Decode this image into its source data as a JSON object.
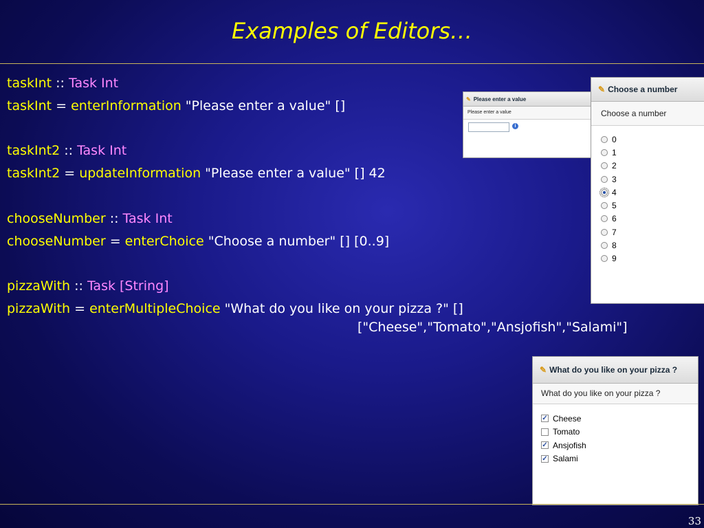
{
  "slide": {
    "title": "Examples of Editors…",
    "page_number": "33"
  },
  "code": {
    "l1": {
      "name": "taskInt",
      "op": " :: ",
      "type": "Task Int"
    },
    "l2": {
      "name": "taskInt",
      "op": " = ",
      "fn": "enterInformation",
      "rest": " \"Please enter a value\" []"
    },
    "l3": {
      "name": "taskInt2",
      "op": " :: ",
      "type": "Task Int"
    },
    "l4": {
      "name": "taskInt2",
      "op": " = ",
      "fn": "updateInformation",
      "rest": " \"Please enter a value\" [] 42"
    },
    "l5": {
      "name": "chooseNumber",
      "op": " :: ",
      "type": "Task Int"
    },
    "l6": {
      "name": "chooseNumber",
      "op": " = ",
      "fn": "enterChoice",
      "rest": " \"Choose a number\" [] [0..9]"
    },
    "l7": {
      "name": "pizzaWith",
      "op": " :: ",
      "type": "Task [String]"
    },
    "l8": {
      "name": "pizzaWith",
      "op": " = ",
      "fn": "enterMultipleChoice",
      "rest": " \"What do you like on your pizza ?\" []"
    },
    "l9": {
      "rest": "[\"Cheese\",\"Tomato\",\"Ansjofish\",\"Salami\"]"
    }
  },
  "panel_enter_value": {
    "header": "Please enter a value",
    "prompt": "Please enter a value",
    "input_value": "",
    "info_icon": "info-icon"
  },
  "panel_choose_number": {
    "header": "Choose a number",
    "prompt": "Choose a number",
    "options": [
      "0",
      "1",
      "2",
      "3",
      "4",
      "5",
      "6",
      "7",
      "8",
      "9"
    ],
    "selected": "4"
  },
  "panel_pizza": {
    "header": "What do you like on your pizza ?",
    "prompt": "What do you like on your pizza ?",
    "options": [
      {
        "label": "Cheese",
        "checked": true
      },
      {
        "label": "Tomato",
        "checked": false
      },
      {
        "label": "Ansjofish",
        "checked": true
      },
      {
        "label": "Salami",
        "checked": true
      }
    ]
  },
  "colors": {
    "title": "#ffff00",
    "identifier": "#ffff00",
    "type": "#ff88ff",
    "accent_rule": "#c8b45a"
  }
}
